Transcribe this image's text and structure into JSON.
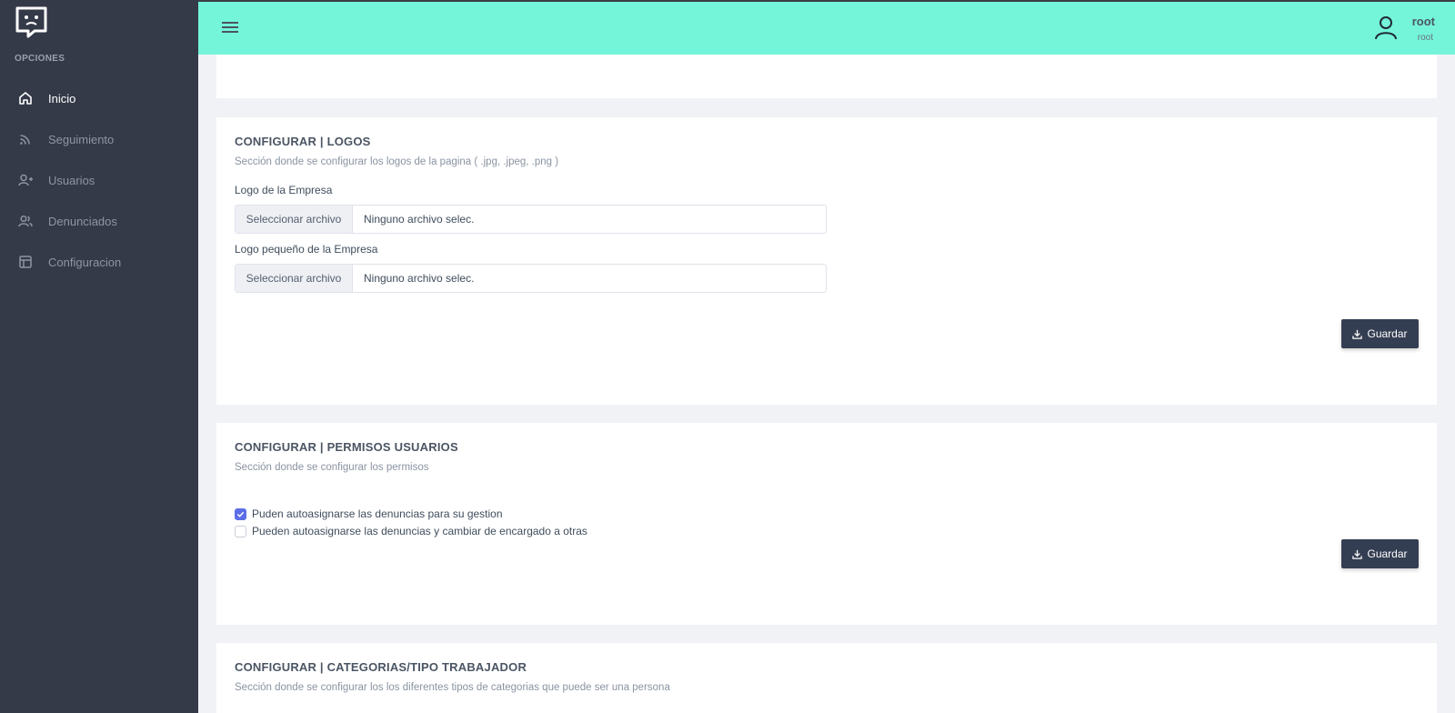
{
  "sidebar": {
    "section_label": "OPCIONES",
    "items": [
      {
        "label": "Inicio",
        "icon": "home-icon",
        "active": true
      },
      {
        "label": "Seguimiento",
        "icon": "rss-icon",
        "active": false
      },
      {
        "label": "Usuarios",
        "icon": "user-plus-icon",
        "active": false
      },
      {
        "label": "Denunciados",
        "icon": "users-icon",
        "active": false
      },
      {
        "label": "Configuracion",
        "icon": "layout-icon",
        "active": false
      }
    ]
  },
  "header": {
    "user_name": "root",
    "user_role": "root",
    "accent_color": "#74f5da"
  },
  "logos": {
    "title": "CONFIGURAR | LOGOS",
    "subtitle": "Sección donde se configurar los logos de la pagina ( .jpg, .jpeg, .png )",
    "field1_label": "Logo de la Empresa",
    "field2_label": "Logo pequeño de la Empresa",
    "file_button": "Seleccionar archivo",
    "file_none": "Ninguno archivo selec.",
    "save_label": "Guardar"
  },
  "permisos": {
    "title": "CONFIGURAR | PERMISOS USUARIOS",
    "subtitle": "Sección donde se configurar los permisos",
    "options": [
      {
        "label": "Puden autoasignarse las denuncias para su gestion",
        "checked": true
      },
      {
        "label": "Pueden autoasignarse las denuncias y cambiar de encargado a otras",
        "checked": false
      }
    ],
    "save_label": "Guardar"
  },
  "categorias": {
    "title": "CONFIGURAR | CATEGORIAS/TIPO TRABAJADOR",
    "subtitle": "Sección donde se configurar los los diferentes tipos de categorias que puede ser una persona"
  }
}
